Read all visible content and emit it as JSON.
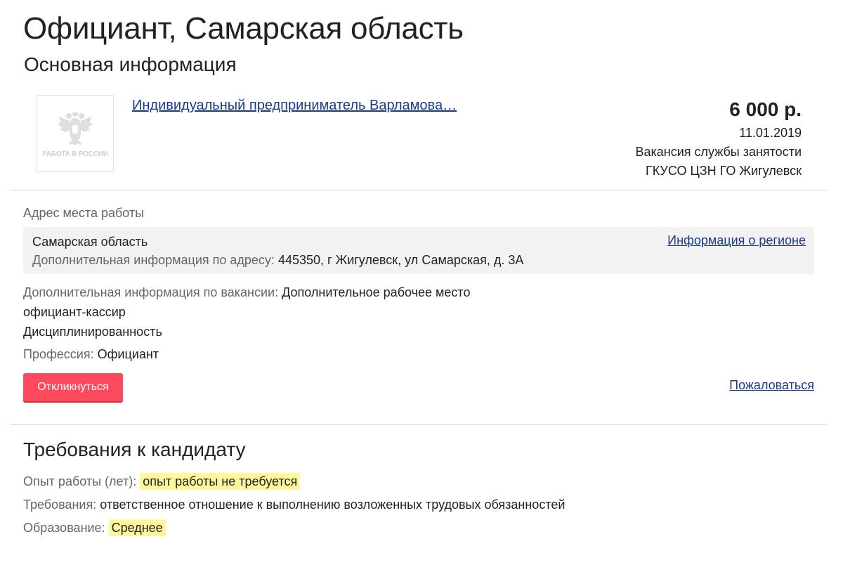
{
  "header": {
    "title": "Официант, Самарская область",
    "subtitle": "Основная информация"
  },
  "employer": {
    "logo_text": "РАБОТА В РОССИИ",
    "logo_icon": "double-headed-eagle-icon",
    "name": "Индивидуальный предприниматель Варламова…"
  },
  "vacancy": {
    "salary": "6 000 р.",
    "date": "11.01.2019",
    "source": "Вакансия службы занятости",
    "agency": "ГКУСО ЦЗН ГО Жигулевск"
  },
  "address": {
    "label": "Адрес места работы",
    "region": "Самарская область",
    "extra_label": "Дополнительная информация по адресу:",
    "extra_value": "445350, г Жигулевск, ул Самарская, д. 3А",
    "region_link": "Информация о регионе"
  },
  "details": {
    "extra_label": "Дополнительная информация по вакансии:",
    "extra_lines": [
      "Дополнительное рабочее место",
      "официант-кассир",
      "Дисциплинированность"
    ],
    "profession_label": "Профессия:",
    "profession_value": "Официант"
  },
  "actions": {
    "respond_label": "Откликнуться",
    "complain_label": "Пожаловаться"
  },
  "requirements": {
    "title": "Требования к кандидату",
    "experience_label": "Опыт работы (лет):",
    "experience_value": "опыт работы не требуется",
    "requirements_label": "Требования:",
    "requirements_value": "ответственное отношение к выполнению возложенных трудовых обязанностей",
    "education_label": "Образование:",
    "education_value": "Среднее"
  },
  "colors": {
    "accent_button": "#ff4a5e",
    "link": "#1a3c8c",
    "highlight": "#fff79a",
    "address_bg": "#f2f2f2"
  }
}
